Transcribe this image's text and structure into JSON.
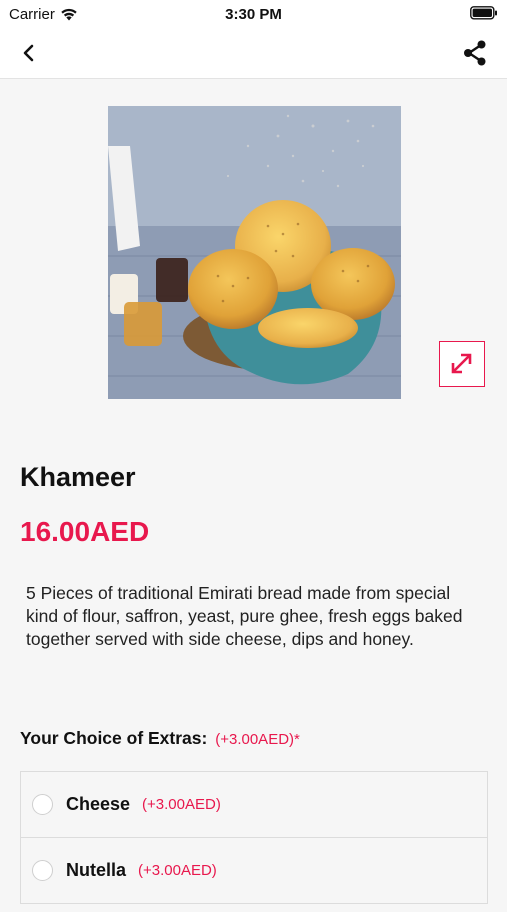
{
  "status": {
    "carrier": "Carrier",
    "time": "3:30 PM"
  },
  "product": {
    "name": "Khameer",
    "price": "16.00AED",
    "description": "5 Pieces of traditional Emirati bread made from special kind of flour, saffron, yeast, pure ghee, fresh eggs baked together served with side cheese, dips and honey."
  },
  "extras": {
    "label": "Your Choice of Extras:",
    "price_note": "(+3.00AED)*",
    "options": [
      {
        "name": "Cheese",
        "price": "(+3.00AED)"
      },
      {
        "name": "Nutella",
        "price": "(+3.00AED)"
      }
    ]
  },
  "colors": {
    "accent": "#e8184d",
    "background": "#f6f6f6"
  },
  "icons": {
    "back": "chevron-left-icon",
    "share": "share-icon",
    "expand": "expand-arrows-icon"
  }
}
